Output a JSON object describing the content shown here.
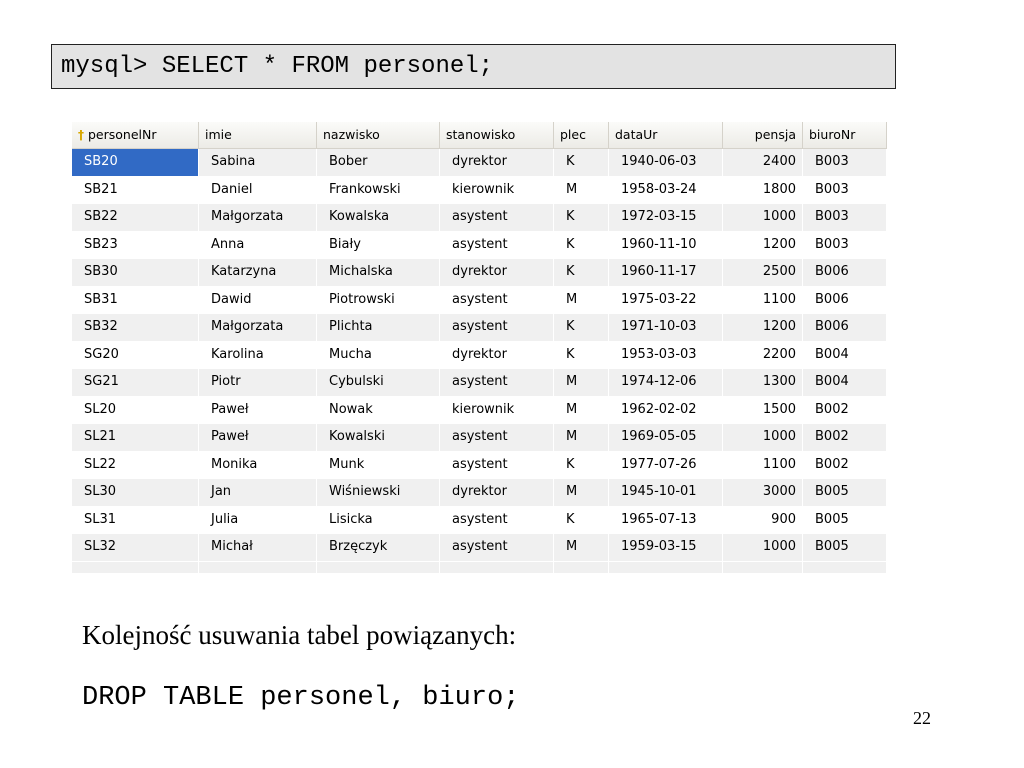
{
  "query": "mysql> SELECT * FROM personel;",
  "grid": {
    "columns": [
      "personelNr",
      "imie",
      "nazwisko",
      "stanowisko",
      "plec",
      "dataUr",
      "pensja",
      "biuroNr"
    ],
    "key_icon": "key-icon",
    "rows": [
      [
        "SB20",
        "Sabina",
        "Bober",
        "dyrektor",
        "K",
        "1940-06-03",
        "2400",
        "B003"
      ],
      [
        "SB21",
        "Daniel",
        "Frankowski",
        "kierownik",
        "M",
        "1958-03-24",
        "1800",
        "B003"
      ],
      [
        "SB22",
        "Małgorzata",
        "Kowalska",
        "asystent",
        "K",
        "1972-03-15",
        "1000",
        "B003"
      ],
      [
        "SB23",
        "Anna",
        "Biały",
        "asystent",
        "K",
        "1960-11-10",
        "1200",
        "B003"
      ],
      [
        "SB30",
        "Katarzyna",
        "Michalska",
        "dyrektor",
        "K",
        "1960-11-17",
        "2500",
        "B006"
      ],
      [
        "SB31",
        "Dawid",
        "Piotrowski",
        "asystent",
        "M",
        "1975-03-22",
        "1100",
        "B006"
      ],
      [
        "SB32",
        "Małgorzata",
        "Plichta",
        "asystent",
        "K",
        "1971-10-03",
        "1200",
        "B006"
      ],
      [
        "SG20",
        "Karolina",
        "Mucha",
        "dyrektor",
        "K",
        "1953-03-03",
        "2200",
        "B004"
      ],
      [
        "SG21",
        "Piotr",
        "Cybulski",
        "asystent",
        "M",
        "1974-12-06",
        "1300",
        "B004"
      ],
      [
        "SL20",
        "Paweł",
        "Nowak",
        "kierownik",
        "M",
        "1962-02-02",
        "1500",
        "B002"
      ],
      [
        "SL21",
        "Paweł",
        "Kowalski",
        "asystent",
        "M",
        "1969-05-05",
        "1000",
        "B002"
      ],
      [
        "SL22",
        "Monika",
        "Munk",
        "asystent",
        "K",
        "1977-07-26",
        "1100",
        "B002"
      ],
      [
        "SL30",
        "Jan",
        "Wiśniewski",
        "dyrektor",
        "M",
        "1945-10-01",
        "3000",
        "B005"
      ],
      [
        "SL31",
        "Julia",
        "Lisicka",
        "asystent",
        "K",
        "1965-07-13",
        "900",
        "B005"
      ],
      [
        "SL32",
        "Michał",
        "Brzęczyk",
        "asystent",
        "M",
        "1959-03-15",
        "1000",
        "B005"
      ]
    ],
    "selected_row": 0,
    "numeric_column": 6,
    "colors": {
      "selection": "#316ac5",
      "stripe": "#f0f0f0",
      "key": "#d8a800"
    }
  },
  "note": "Kolejność usuwania tabel powiązanych:",
  "drop_statement": "DROP TABLE personel, biuro;",
  "page_number": "22"
}
